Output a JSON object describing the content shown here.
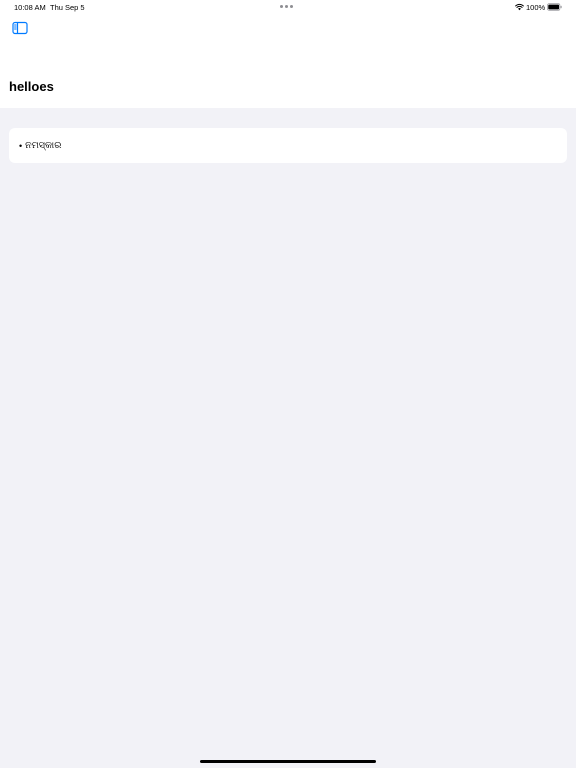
{
  "status_bar": {
    "time": "10:08 AM",
    "date": "Thu Sep 5",
    "battery_percent": "100%",
    "icons": [
      "wifi-icon",
      "battery-icon"
    ]
  },
  "nav": {
    "sidebar_toggle_icon": "sidebar-icon"
  },
  "page": {
    "title": "helloes"
  },
  "list": {
    "items": [
      {
        "bullet": "•",
        "text": "ନମସ୍କାର"
      }
    ]
  },
  "colors": {
    "accent": "#007aff",
    "background": "#f2f2f7",
    "card": "#ffffff"
  }
}
